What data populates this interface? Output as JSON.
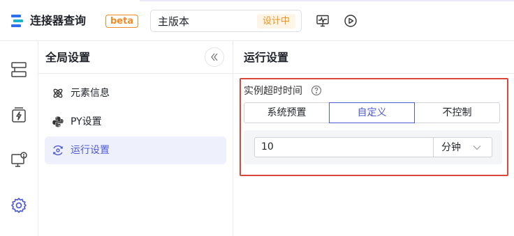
{
  "header": {
    "app_title": "连接器查询",
    "beta_label": "beta",
    "version_name": "主版本",
    "version_status": "设计中",
    "icons": [
      "logo-icon",
      "monitor-wave-icon",
      "play-circle-icon"
    ]
  },
  "rail": {
    "icons": [
      "layers-icon",
      "flash-box-icon",
      "monitor-settings-icon",
      "gear-icon"
    ],
    "active": "gear-icon"
  },
  "nav": {
    "title": "全局设置",
    "items": [
      {
        "label": "元素信息",
        "icon": "atom-icon"
      },
      {
        "label": "PY设置",
        "icon": "python-icon"
      },
      {
        "label": "运行设置",
        "icon": "run-settings-icon"
      }
    ],
    "active_index": 2
  },
  "main": {
    "title": "运行设置",
    "timeout_label": "实例超时时间",
    "options": [
      "系统预置",
      "自定义",
      "不控制"
    ],
    "selected_option": "自定义",
    "timeout_value": "10",
    "unit": "分钟"
  },
  "colors": {
    "accent": "#4f5bd5",
    "beta_orange": "#f08a24",
    "status_orange": "#f0921e",
    "highlight_red": "#d9463a"
  }
}
